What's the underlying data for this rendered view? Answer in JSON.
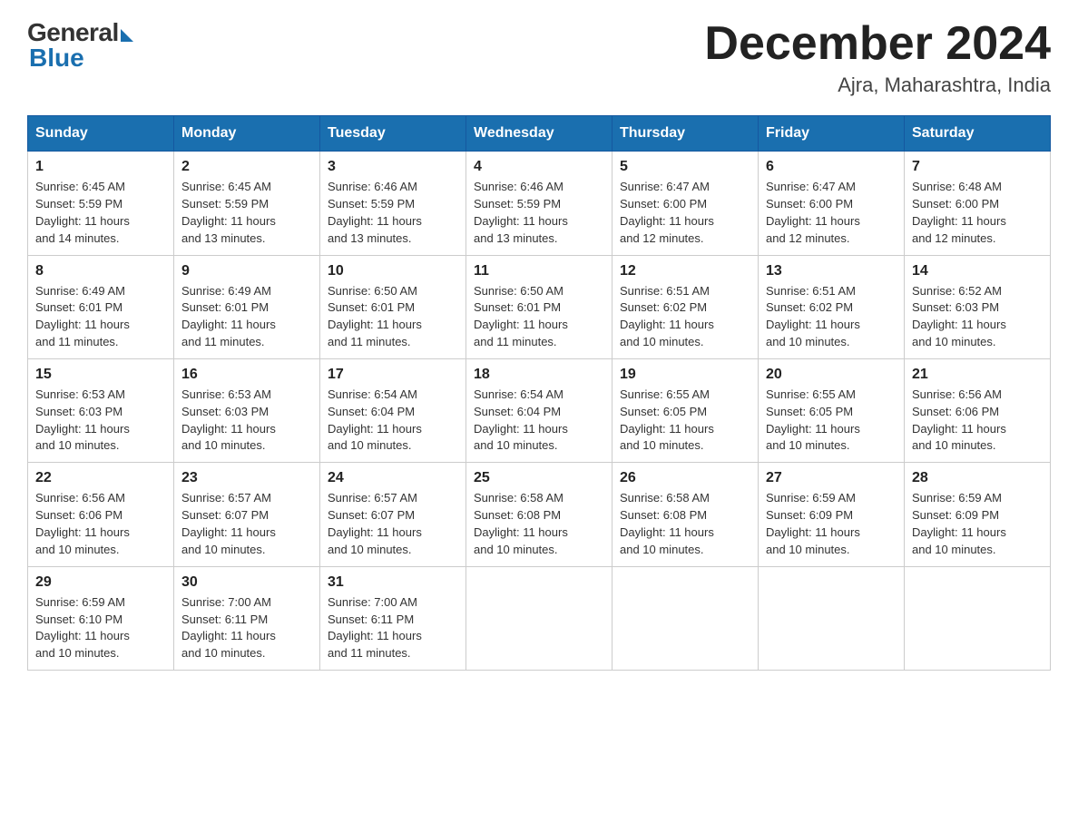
{
  "header": {
    "logo": {
      "general": "General",
      "blue": "Blue"
    },
    "title": "December 2024",
    "location": "Ajra, Maharashtra, India"
  },
  "calendar": {
    "days_of_week": [
      "Sunday",
      "Monday",
      "Tuesday",
      "Wednesday",
      "Thursday",
      "Friday",
      "Saturday"
    ],
    "weeks": [
      [
        {
          "day": "1",
          "sunrise": "6:45 AM",
          "sunset": "5:59 PM",
          "daylight": "11 hours and 14 minutes."
        },
        {
          "day": "2",
          "sunrise": "6:45 AM",
          "sunset": "5:59 PM",
          "daylight": "11 hours and 13 minutes."
        },
        {
          "day": "3",
          "sunrise": "6:46 AM",
          "sunset": "5:59 PM",
          "daylight": "11 hours and 13 minutes."
        },
        {
          "day": "4",
          "sunrise": "6:46 AM",
          "sunset": "5:59 PM",
          "daylight": "11 hours and 13 minutes."
        },
        {
          "day": "5",
          "sunrise": "6:47 AM",
          "sunset": "6:00 PM",
          "daylight": "11 hours and 12 minutes."
        },
        {
          "day": "6",
          "sunrise": "6:47 AM",
          "sunset": "6:00 PM",
          "daylight": "11 hours and 12 minutes."
        },
        {
          "day": "7",
          "sunrise": "6:48 AM",
          "sunset": "6:00 PM",
          "daylight": "11 hours and 12 minutes."
        }
      ],
      [
        {
          "day": "8",
          "sunrise": "6:49 AM",
          "sunset": "6:01 PM",
          "daylight": "11 hours and 11 minutes."
        },
        {
          "day": "9",
          "sunrise": "6:49 AM",
          "sunset": "6:01 PM",
          "daylight": "11 hours and 11 minutes."
        },
        {
          "day": "10",
          "sunrise": "6:50 AM",
          "sunset": "6:01 PM",
          "daylight": "11 hours and 11 minutes."
        },
        {
          "day": "11",
          "sunrise": "6:50 AM",
          "sunset": "6:01 PM",
          "daylight": "11 hours and 11 minutes."
        },
        {
          "day": "12",
          "sunrise": "6:51 AM",
          "sunset": "6:02 PM",
          "daylight": "11 hours and 10 minutes."
        },
        {
          "day": "13",
          "sunrise": "6:51 AM",
          "sunset": "6:02 PM",
          "daylight": "11 hours and 10 minutes."
        },
        {
          "day": "14",
          "sunrise": "6:52 AM",
          "sunset": "6:03 PM",
          "daylight": "11 hours and 10 minutes."
        }
      ],
      [
        {
          "day": "15",
          "sunrise": "6:53 AM",
          "sunset": "6:03 PM",
          "daylight": "11 hours and 10 minutes."
        },
        {
          "day": "16",
          "sunrise": "6:53 AM",
          "sunset": "6:03 PM",
          "daylight": "11 hours and 10 minutes."
        },
        {
          "day": "17",
          "sunrise": "6:54 AM",
          "sunset": "6:04 PM",
          "daylight": "11 hours and 10 minutes."
        },
        {
          "day": "18",
          "sunrise": "6:54 AM",
          "sunset": "6:04 PM",
          "daylight": "11 hours and 10 minutes."
        },
        {
          "day": "19",
          "sunrise": "6:55 AM",
          "sunset": "6:05 PM",
          "daylight": "11 hours and 10 minutes."
        },
        {
          "day": "20",
          "sunrise": "6:55 AM",
          "sunset": "6:05 PM",
          "daylight": "11 hours and 10 minutes."
        },
        {
          "day": "21",
          "sunrise": "6:56 AM",
          "sunset": "6:06 PM",
          "daylight": "11 hours and 10 minutes."
        }
      ],
      [
        {
          "day": "22",
          "sunrise": "6:56 AM",
          "sunset": "6:06 PM",
          "daylight": "11 hours and 10 minutes."
        },
        {
          "day": "23",
          "sunrise": "6:57 AM",
          "sunset": "6:07 PM",
          "daylight": "11 hours and 10 minutes."
        },
        {
          "day": "24",
          "sunrise": "6:57 AM",
          "sunset": "6:07 PM",
          "daylight": "11 hours and 10 minutes."
        },
        {
          "day": "25",
          "sunrise": "6:58 AM",
          "sunset": "6:08 PM",
          "daylight": "11 hours and 10 minutes."
        },
        {
          "day": "26",
          "sunrise": "6:58 AM",
          "sunset": "6:08 PM",
          "daylight": "11 hours and 10 minutes."
        },
        {
          "day": "27",
          "sunrise": "6:59 AM",
          "sunset": "6:09 PM",
          "daylight": "11 hours and 10 minutes."
        },
        {
          "day": "28",
          "sunrise": "6:59 AM",
          "sunset": "6:09 PM",
          "daylight": "11 hours and 10 minutes."
        }
      ],
      [
        {
          "day": "29",
          "sunrise": "6:59 AM",
          "sunset": "6:10 PM",
          "daylight": "11 hours and 10 minutes."
        },
        {
          "day": "30",
          "sunrise": "7:00 AM",
          "sunset": "6:11 PM",
          "daylight": "11 hours and 10 minutes."
        },
        {
          "day": "31",
          "sunrise": "7:00 AM",
          "sunset": "6:11 PM",
          "daylight": "11 hours and 11 minutes."
        },
        null,
        null,
        null,
        null
      ]
    ],
    "labels": {
      "sunrise": "Sunrise:",
      "sunset": "Sunset:",
      "daylight": "Daylight:"
    }
  }
}
